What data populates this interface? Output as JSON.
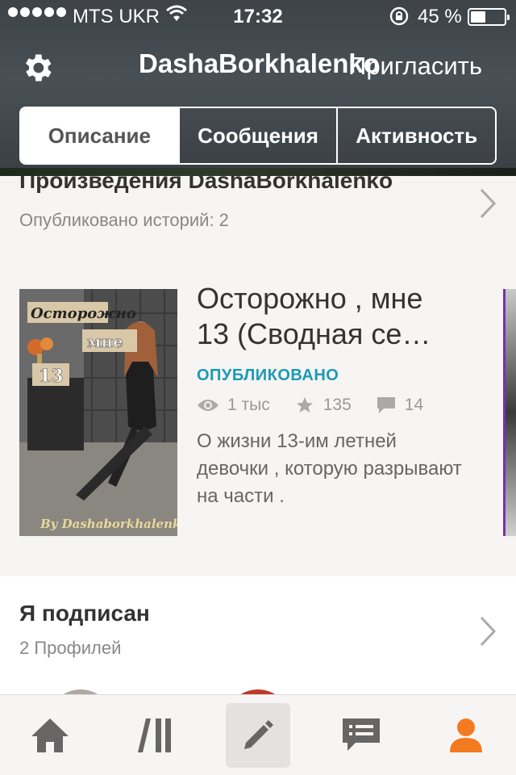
{
  "status_bar": {
    "carrier": "MTS UKR",
    "time": "17:32",
    "battery_percent": "45 %",
    "battery_level": 0.45
  },
  "header": {
    "title": "DashaBorkhalenko",
    "invite_label": "Пригласить"
  },
  "tabs": [
    {
      "label": "Описание",
      "active": true
    },
    {
      "label": "Сообщения",
      "active": false
    },
    {
      "label": "Активность",
      "active": false
    }
  ],
  "works": {
    "title": "Произведения DashaBorkhalenko",
    "subtitle": "Опубликовано историй: 2"
  },
  "story": {
    "cover_text_top": "Осторожно",
    "cover_text_mid": "мне",
    "cover_text_num": "13",
    "cover_credit": "By Dashaborkhalenko",
    "title_line1": "Осторожно , мне",
    "title_line2": "13 (Сводная се…",
    "status": "ОПУБЛИКОВАНО",
    "views": "1 тыс",
    "votes": "135",
    "comments": "14",
    "description": "О жизни 13-им летней девочки , которую разрывают на части ."
  },
  "following": {
    "title": "Я подписан",
    "subtitle": "2 Профилей"
  },
  "colors": {
    "accent_orange": "#f47a20",
    "published_teal": "#1a9bb5",
    "nav_gray": "#666666"
  }
}
